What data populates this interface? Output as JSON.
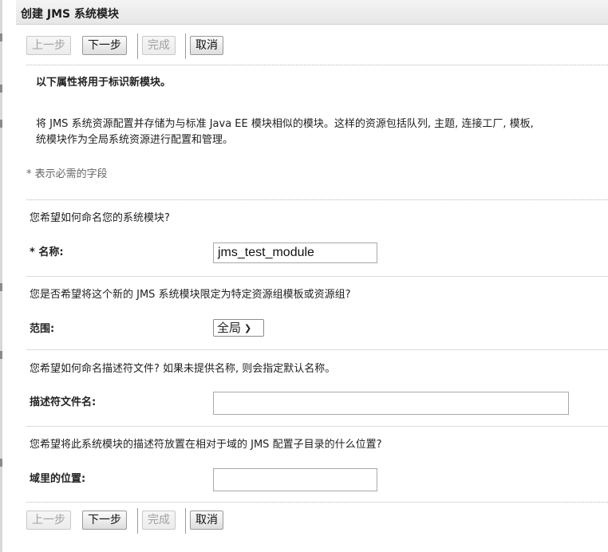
{
  "window": {
    "title": "创建 JMS 系统模块"
  },
  "buttons": {
    "back": "上一步",
    "next": "下一步",
    "finish": "完成",
    "cancel": "取消"
  },
  "intro": {
    "heading": "以下属性将用于标识新模块。",
    "description_line1": "将 JMS 系统资源配置并存储为与标准 Java EE 模块相似的模块。这样的资源包括队列, 主题, 连接工厂, 模板,",
    "description_line2": "统模块作为全局系统资源进行配置和管理。",
    "required_note": "* 表示必需的字段"
  },
  "sections": {
    "name": {
      "question": "您希望如何命名您的系统模块?",
      "label": "* 名称:",
      "value": "jms_test_module"
    },
    "scope": {
      "question": "您是否希望将这个新的 JMS 系统模块限定为特定资源组模板或资源组?",
      "label": "范围:",
      "selected": "全局"
    },
    "descriptor": {
      "question": "您希望如何命名描述符文件? 如果未提供名称, 则会指定默认名称。",
      "label": "描述符文件名:",
      "value": ""
    },
    "location": {
      "question": "您希望将此系统模块的描述符放置在相对于域的 JMS 配置子目录的什么位置?",
      "label": "域里的位置:",
      "value": ""
    }
  }
}
